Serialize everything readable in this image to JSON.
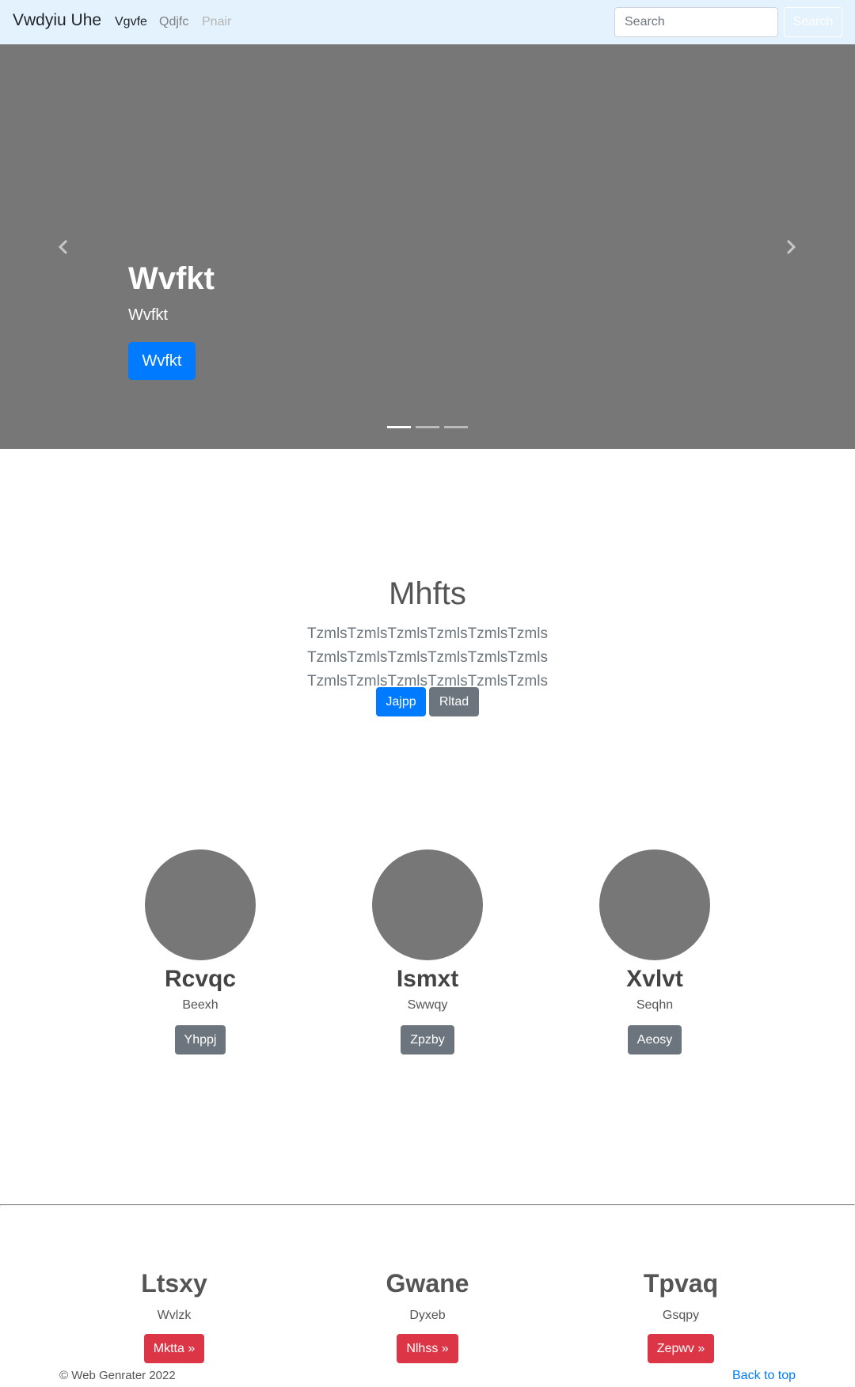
{
  "navbar": {
    "brand": "Vwdyiu Uhe",
    "links": [
      "Vgvfe",
      "Qdjfc",
      "Pnair"
    ],
    "search_placeholder": "Search",
    "search_button": "Search"
  },
  "carousel": {
    "title": "Wvfkt",
    "subtitle": "Wvfkt",
    "button": "Wvfkt",
    "slide_count": 3,
    "active_slide": 1,
    "prev_icon": "chevron-left-icon",
    "next_icon": "chevron-right-icon"
  },
  "intro": {
    "title": "Mhfts",
    "lead": "TzmlsTzmlsTzmlsTzmlsTzmlsTzmls TzmlsTzmlsTzmlsTzmlsTzmlsTzmls TzmlsTzmlsTzmlsTzmlsTzmlsTzmls",
    "primary_button": "Jajpp",
    "secondary_button": "Rltad"
  },
  "features": [
    {
      "title": "Rcvqc",
      "text": "Beexh",
      "button": "Yhppj"
    },
    {
      "title": "Ismxt",
      "text": "Swwqy",
      "button": "Zpzby"
    },
    {
      "title": "Xvlvt",
      "text": "Seqhn",
      "button": "Aeosy"
    }
  ],
  "footer_columns": [
    {
      "title": "Ltsxy",
      "text": "Wvlzk",
      "button": "Mktta »"
    },
    {
      "title": "Gwane",
      "text": "Dyxeb",
      "button": "Nlhss »"
    },
    {
      "title": "Tpvaq",
      "text": "Gsqpy",
      "button": "Zepwv »"
    }
  ],
  "footer": {
    "copyright": "© Web Genrater 2022",
    "back_to_top": "Back to top"
  },
  "colors": {
    "navbar_bg": "#e3f2fd",
    "primary": "#007bff",
    "secondary": "#6c757d",
    "danger": "#dc3545",
    "placeholder_gray": "#777777"
  }
}
